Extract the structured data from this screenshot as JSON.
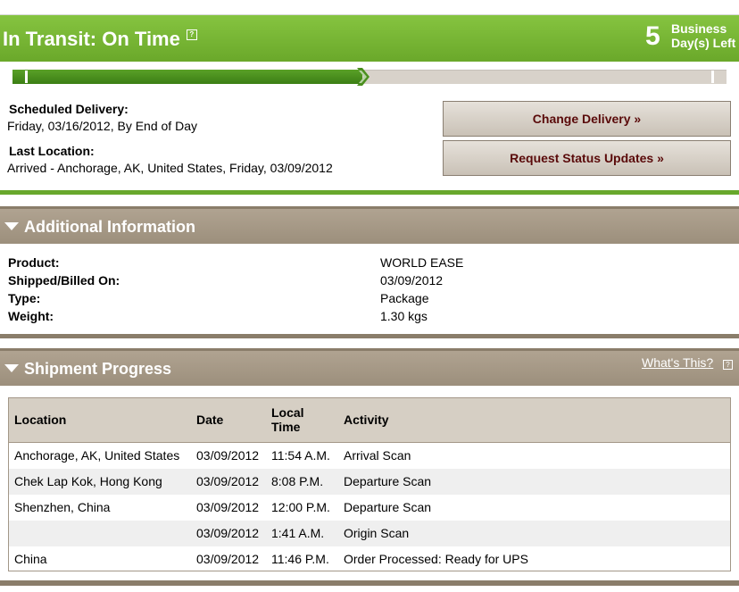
{
  "status": {
    "title": "In Transit: On Time",
    "help_icon": "?",
    "days_number": "5",
    "days_line1": "Business",
    "days_line2": "Day(s) Left",
    "progress_percent": 49
  },
  "delivery": {
    "scheduled_label": "Scheduled Delivery:",
    "scheduled_value": "Friday, 03/16/2012, By End of Day",
    "last_location_label": "Last Location:",
    "last_location_value": "Arrived - Anchorage, AK, United States, Friday, 03/09/2012"
  },
  "buttons": {
    "change_delivery": "Change Delivery »",
    "request_updates": "Request Status Updates »"
  },
  "additional_info": {
    "header": "Additional Information",
    "rows": [
      {
        "key": "Product:",
        "value": "WORLD EASE"
      },
      {
        "key": "Shipped/Billed On:",
        "value": "03/09/2012"
      },
      {
        "key": "Type:",
        "value": "Package"
      },
      {
        "key": "Weight:",
        "value": "1.30 kgs"
      }
    ]
  },
  "shipment_progress": {
    "header": "Shipment Progress",
    "whats_this": "What's This?",
    "whats_icon": "?",
    "columns": {
      "location": "Location",
      "date": "Date",
      "time": "Local Time",
      "activity": "Activity"
    },
    "rows": [
      {
        "location": "Anchorage, AK, United States",
        "date": "03/09/2012",
        "time": "11:54 A.M.",
        "activity": "Arrival Scan"
      },
      {
        "location": "Chek Lap Kok, Hong Kong",
        "date": "03/09/2012",
        "time": "8:08 P.M.",
        "activity": "Departure Scan"
      },
      {
        "location": "Shenzhen, China",
        "date": "03/09/2012",
        "time": "12:00 P.M.",
        "activity": "Departure Scan"
      },
      {
        "location": "",
        "date": "03/09/2012",
        "time": "1:41 A.M.",
        "activity": "Origin Scan"
      },
      {
        "location": "China",
        "date": "03/09/2012",
        "time": "11:46 P.M.",
        "activity": "Order Processed: Ready for UPS"
      }
    ]
  },
  "colors": {
    "status_green": "#76b535",
    "progress_green": "#4a8f1e",
    "section_tan": "#a69985",
    "button_text": "#5a0a0a"
  }
}
